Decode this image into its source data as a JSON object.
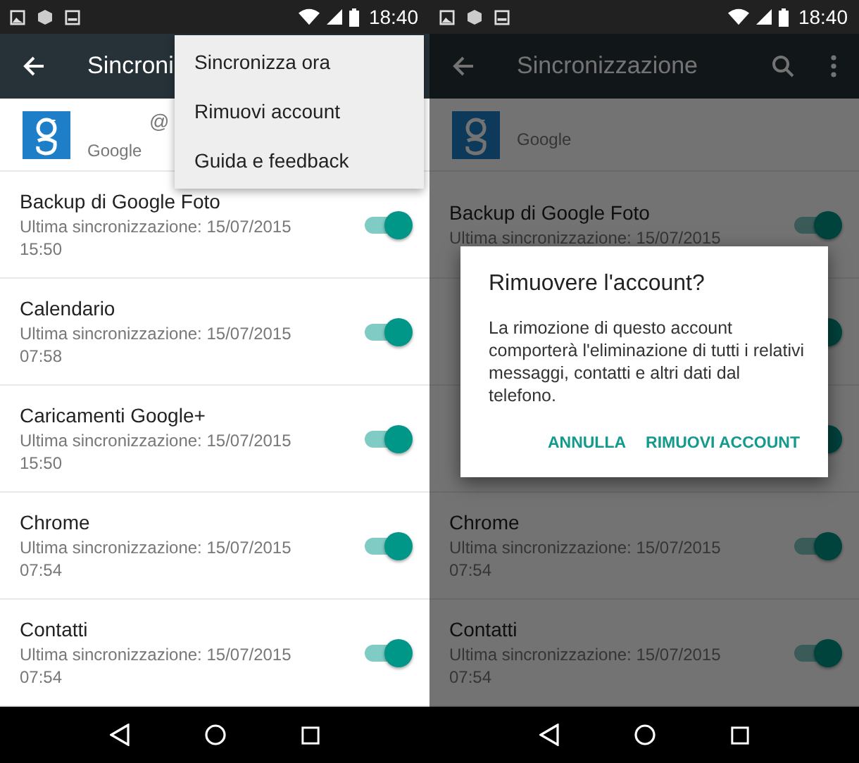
{
  "phones": [
    {
      "status_time": "18:40",
      "title": "Sincroni",
      "account": {
        "email": "@",
        "provider": "Google"
      },
      "items": [
        {
          "title": "Backup di Google Foto",
          "subtitle": "Ultima sincronizzazione: 15/07/2015",
          "time": "15:50",
          "on": true
        },
        {
          "title": "Calendario",
          "subtitle": "Ultima sincronizzazione: 15/07/2015",
          "time": "07:58",
          "on": true
        },
        {
          "title": "Caricamenti Google+",
          "subtitle": "Ultima sincronizzazione: 15/07/2015",
          "time": "15:50",
          "on": true
        },
        {
          "title": "Chrome",
          "subtitle": "Ultima sincronizzazione: 15/07/2015",
          "time": "07:54",
          "on": true
        },
        {
          "title": "Contatti",
          "subtitle": "Ultima sincronizzazione: 15/07/2015",
          "time": "07:54",
          "on": true
        }
      ],
      "menu": {
        "items": [
          "Sincronizza ora",
          "Rimuovi account",
          "Guida e feedback"
        ]
      }
    },
    {
      "status_time": "18:40",
      "title": "Sincronizzazione",
      "account": {
        "provider": "Google"
      },
      "items": [
        {
          "title": "Backup di Google Foto",
          "subtitle": "Ultima sincronizzazione: 15/07/2015",
          "on": true
        },
        {
          "on": true
        },
        {
          "on": true
        },
        {
          "title": "Chrome",
          "subtitle": "Ultima sincronizzazione: 15/07/2015",
          "time": "07:54",
          "on": true
        },
        {
          "title": "Contatti",
          "subtitle": "Ultima sincronizzazione: 15/07/2015",
          "time": "07:54",
          "on": true
        }
      ],
      "dialog": {
        "title": "Rimuovere l'account?",
        "message": "La rimozione di questo account comporterà l'eliminazione di tutti i relativi messaggi, contatti e altri dati dal telefono.",
        "buttons": [
          "ANNULLA",
          "RIMUOVI ACCOUNT"
        ]
      }
    }
  ]
}
